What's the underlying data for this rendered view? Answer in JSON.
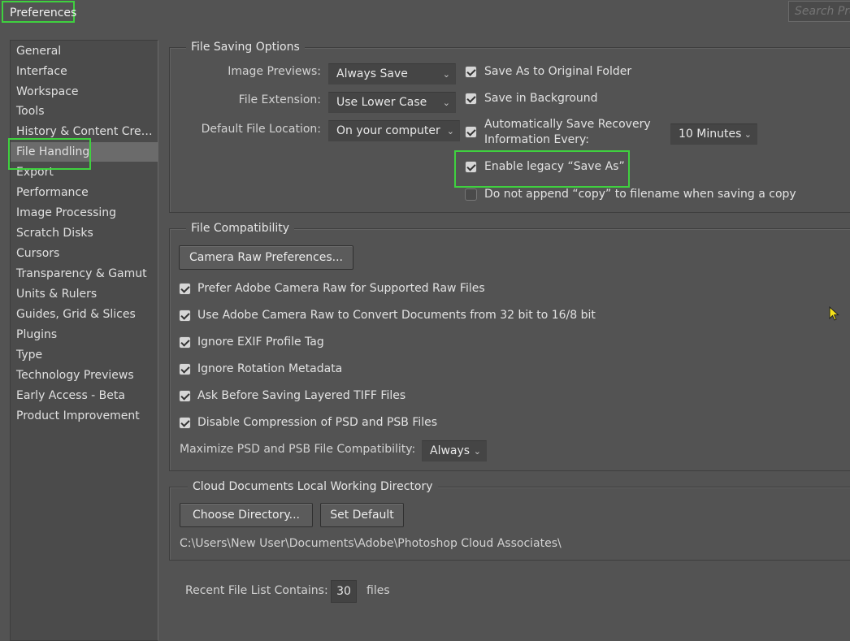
{
  "window": {
    "title": "Preferences"
  },
  "search": {
    "placeholder": "Search Pre"
  },
  "sidebar": {
    "items": [
      "General",
      "Interface",
      "Workspace",
      "Tools",
      "History & Content Creden...",
      "File Handling",
      "Export",
      "Performance",
      "Image Processing",
      "Scratch Disks",
      "Cursors",
      "Transparency & Gamut",
      "Units & Rulers",
      "Guides, Grid & Slices",
      "Plugins",
      "Type",
      "Technology Previews",
      "Early Access - Beta",
      "Product Improvement"
    ],
    "active_index": 5
  },
  "file_saving": {
    "legend": "File Saving Options",
    "image_previews_label": "Image Previews:",
    "image_previews_value": "Always Save",
    "file_extension_label": "File Extension:",
    "file_extension_value": "Use Lower Case",
    "default_location_label": "Default File Location:",
    "default_location_value": "On your computer",
    "save_original_folder": "Save As to Original Folder",
    "save_background": "Save in Background",
    "auto_save_line1": "Automatically Save Recovery",
    "auto_save_line2": "Information Every:",
    "auto_save_interval": "10 Minutes",
    "enable_legacy": "Enable legacy “Save As”",
    "no_append_copy": "Do not append “copy” to filename when saving a copy"
  },
  "file_compat": {
    "legend": "File Compatibility",
    "camera_raw_button": "Camera Raw Preferences...",
    "prefer_acr": "Prefer Adobe Camera Raw for Supported Raw Files",
    "use_acr_convert": "Use Adobe Camera Raw to Convert Documents from 32 bit to 16/8 bit",
    "ignore_exif": "Ignore EXIF Profile Tag",
    "ignore_rotation": "Ignore Rotation Metadata",
    "ask_tiff": "Ask Before Saving Layered TIFF Files",
    "disable_compression": "Disable Compression of PSD and PSB Files",
    "maximize_label": "Maximize PSD and PSB File Compatibility:",
    "maximize_value": "Always"
  },
  "cloud": {
    "legend": "Cloud Documents Local Working Directory",
    "choose_button": "Choose Directory...",
    "default_button": "Set Default",
    "path": "C:\\Users\\New User\\Documents\\Adobe\\Photoshop Cloud Associates\\"
  },
  "recent": {
    "label": "Recent File List Contains:",
    "value": "30",
    "suffix": "files"
  },
  "colors": {
    "highlight": "#3fd13f",
    "background": "#535353",
    "active_item": "#6b6b6b"
  }
}
